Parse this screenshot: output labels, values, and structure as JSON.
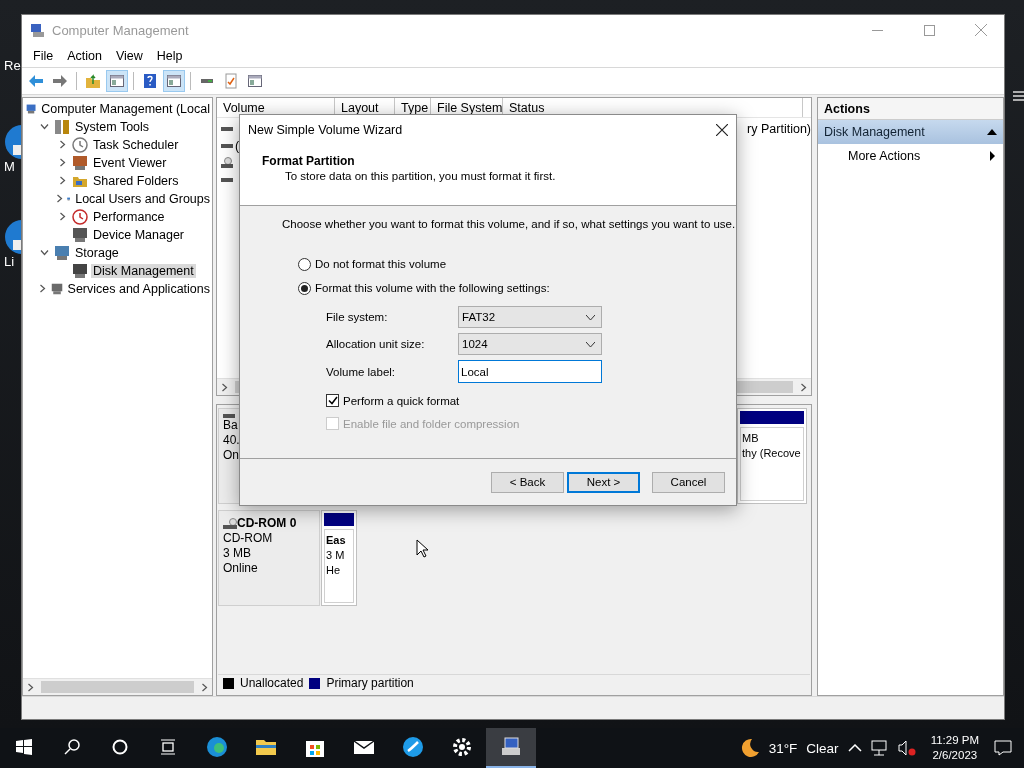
{
  "desktop_icons": [
    {
      "label": "Re"
    },
    {
      "label": "M"
    },
    {
      "label": "Li"
    }
  ],
  "window": {
    "title": "Computer Management"
  },
  "menu": [
    "File",
    "Action",
    "View",
    "Help"
  ],
  "toolbar": [
    {
      "pressed": false
    },
    {
      "pressed": false
    },
    {
      "pressed": false
    },
    {
      "pressed": true
    },
    {
      "pressed": false
    },
    {
      "pressed": true
    },
    {
      "pressed": false
    },
    {
      "pressed": false
    },
    {
      "pressed": false
    }
  ],
  "tree": [
    {
      "label": "Computer Management (Local",
      "selected": false,
      "children": [
        {
          "label": "System Tools",
          "expanded": true,
          "selected": false,
          "children": [
            {
              "label": "Task Scheduler",
              "expanded": false,
              "selected": false
            },
            {
              "label": "Event Viewer",
              "expanded": false,
              "selected": false
            },
            {
              "label": "Shared Folders",
              "expanded": false,
              "selected": false
            },
            {
              "label": "Local Users and Groups",
              "expanded": false,
              "selected": false
            },
            {
              "label": "Performance",
              "expanded": false,
              "selected": false
            },
            {
              "label": "Device Manager",
              "selected": false
            }
          ]
        },
        {
          "label": "Storage",
          "expanded": true,
          "selected": false,
          "children": [
            {
              "label": "Disk Management",
              "selected": true
            }
          ]
        },
        {
          "label": "Services and Applications",
          "expanded": false,
          "selected": false
        }
      ]
    }
  ],
  "table": {
    "columns": [
      "Volume",
      "Layout",
      "Type",
      "File System",
      "Status"
    ],
    "rows": [
      {
        "kind": "drive",
        "status": "ry Partition)"
      },
      {
        "kind": "drive",
        "volume": "("
      },
      {
        "kind": "disc"
      },
      {
        "kind": "drive"
      }
    ]
  },
  "disks": [
    {
      "lines": [
        "Ba",
        "40.",
        "On"
      ],
      "partition_lines": [
        "MB",
        "thy (Recove"
      ]
    },
    {
      "name": "CD-ROM 0",
      "lines": [
        "CD-ROM",
        "3 MB",
        "Online"
      ],
      "partition_title": "Eas",
      "partition_lines": [
        "3 M",
        "He"
      ]
    }
  ],
  "legend": [
    {
      "label": "Unallocated",
      "color": "#000000"
    },
    {
      "label": "Primary partition",
      "color": "#000080"
    }
  ],
  "actions": {
    "title": "Actions",
    "section": {
      "label": "Disk Management",
      "expanded": true
    },
    "items": [
      "More Actions"
    ]
  },
  "dialog": {
    "title": "New Simple Volume Wizard",
    "heading": "Format Partition",
    "subheading": "To store data on this partition, you must format it first.",
    "instruction": "Choose whether you want to format this volume, and if so, what settings you want to use.",
    "options": [
      {
        "label": "Do not format this volume",
        "selected": false
      },
      {
        "label": "Format this volume with the following settings:",
        "selected": true
      }
    ],
    "fields": [
      {
        "label": "File system:",
        "kind": "select",
        "value": "FAT32"
      },
      {
        "label": "Allocation unit size:",
        "kind": "select",
        "value": "1024"
      },
      {
        "label": "Volume label:",
        "kind": "text",
        "value": "Local"
      }
    ],
    "checkboxes": [
      {
        "label": "Perform a quick format",
        "checked": true,
        "disabled": false
      },
      {
        "label": "Enable file and folder compression",
        "checked": false,
        "disabled": true
      }
    ],
    "buttons": [
      {
        "label": "< Back",
        "default": false
      },
      {
        "label": "Next >",
        "default": true
      },
      {
        "label": "Cancel",
        "default": false
      }
    ]
  },
  "taskbar": {
    "apps": [
      {
        "selected": false
      },
      {
        "selected": false
      },
      {
        "selected": false
      },
      {
        "selected": false
      },
      {
        "selected": false
      },
      {
        "selected": false
      },
      {
        "selected": true
      }
    ],
    "temperature": "31°F",
    "weather": "Clear",
    "time": "11:29 PM",
    "date": "2/6/2023"
  }
}
